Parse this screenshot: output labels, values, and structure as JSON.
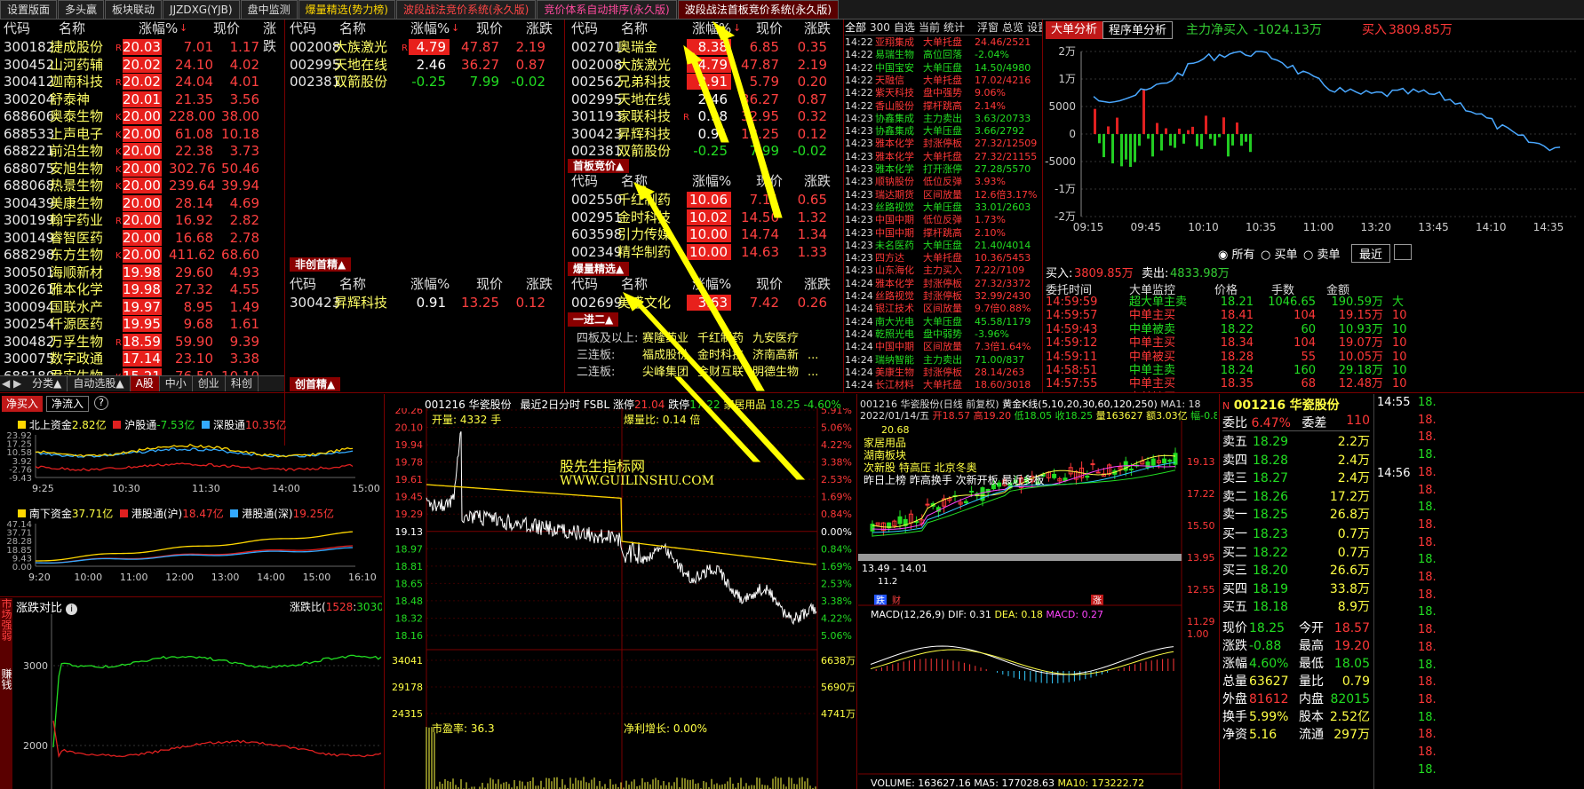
{
  "topbar": {
    "tabs": [
      {
        "label": "设置版面",
        "style": "normal"
      },
      {
        "label": "多头赢",
        "style": "normal"
      },
      {
        "label": "板块联动",
        "style": "normal"
      },
      {
        "label": "JJZDXG(YJB)",
        "style": "normal"
      },
      {
        "label": "盘中监测",
        "style": "normal"
      },
      {
        "label": "爆量精选(势力榜)",
        "style": "yellow"
      },
      {
        "label": "波段战法竞价系统(永久版)",
        "style": "red"
      },
      {
        "label": "竞价体系自动排序(永久版)",
        "style": "pink"
      },
      {
        "label": "波段战法首板竞价系统(永久版)",
        "style": "active"
      }
    ]
  },
  "left_table": {
    "headers": [
      "代码",
      "名称",
      "涨幅%",
      "现价",
      "涨跌"
    ],
    "rows": [
      {
        "code": "300182",
        "name": "捷成股份",
        "mark": "R",
        "pct": "20.03",
        "price": "7.01",
        "chg": "1.17"
      },
      {
        "code": "300452",
        "name": "山河药辅",
        "mark": "",
        "pct": "20.02",
        "price": "24.10",
        "chg": "4.02"
      },
      {
        "code": "300412",
        "name": "迦南科技",
        "mark": "R",
        "pct": "20.02",
        "price": "24.04",
        "chg": "4.01"
      },
      {
        "code": "300204",
        "name": "舒泰神",
        "mark": "",
        "pct": "20.01",
        "price": "21.35",
        "chg": "3.56"
      },
      {
        "code": "688606",
        "name": "奥泰生物",
        "mark": "K",
        "pct": "20.00",
        "price": "228.00",
        "chg": "38.00"
      },
      {
        "code": "688533",
        "name": "上声电子",
        "mark": "K",
        "pct": "20.00",
        "price": "61.08",
        "chg": "10.18"
      },
      {
        "code": "688221",
        "name": "前沿生物",
        "mark": "K",
        "pct": "20.00",
        "price": "22.38",
        "chg": "3.73"
      },
      {
        "code": "688075",
        "name": "安旭生物",
        "mark": "K",
        "pct": "20.00",
        "price": "302.76",
        "chg": "50.46"
      },
      {
        "code": "688068",
        "name": "热景生物",
        "mark": "K",
        "pct": "20.00",
        "price": "239.64",
        "chg": "39.94"
      },
      {
        "code": "300439",
        "name": "美康生物",
        "mark": "",
        "pct": "20.00",
        "price": "28.14",
        "chg": "4.69"
      },
      {
        "code": "300199",
        "name": "翰宇药业",
        "mark": "R",
        "pct": "20.00",
        "price": "16.92",
        "chg": "2.82"
      },
      {
        "code": "300149",
        "name": "睿智医药",
        "mark": "",
        "pct": "20.00",
        "price": "16.68",
        "chg": "2.78"
      },
      {
        "code": "688298",
        "name": "东方生物",
        "mark": "K",
        "pct": "20.00",
        "price": "411.62",
        "chg": "68.60"
      },
      {
        "code": "300501",
        "name": "海顺新材",
        "mark": "",
        "pct": "19.98",
        "price": "29.60",
        "chg": "4.93"
      },
      {
        "code": "300261",
        "name": "雅本化学",
        "mark": "",
        "pct": "19.98",
        "price": "27.32",
        "chg": "4.55"
      },
      {
        "code": "300094",
        "name": "国联水产",
        "mark": "",
        "pct": "19.97",
        "price": "8.95",
        "chg": "1.49"
      },
      {
        "code": "300254",
        "name": "仟源医药",
        "mark": "",
        "pct": "19.95",
        "price": "9.68",
        "chg": "1.61"
      },
      {
        "code": "300482",
        "name": "万孚生物",
        "mark": "R",
        "pct": "18.59",
        "price": "59.90",
        "chg": "9.39"
      },
      {
        "code": "300075",
        "name": "数字政通",
        "mark": "",
        "pct": "17.14",
        "price": "23.10",
        "chg": "3.38"
      },
      {
        "code": "688180",
        "name": "君实生物",
        "mark": "K",
        "pct": "15.21",
        "price": "76.50",
        "chg": "10.10"
      }
    ],
    "bottom_tabs": [
      "分类▲",
      "自动选股▲",
      "A股",
      "中小",
      "创业",
      "科创"
    ]
  },
  "mid_table": {
    "headers": [
      "代码",
      "名称",
      "涨幅%",
      "现价",
      "涨跌"
    ],
    "rows": [
      {
        "code": "002008",
        "name": "大族激光",
        "mark": "R",
        "pct": "4.79",
        "price": "47.87",
        "chg": "2.19",
        "bar": true,
        "neg": false
      },
      {
        "code": "002995",
        "name": "天地在线",
        "mark": "",
        "pct": "2.46",
        "price": "36.27",
        "chg": "0.87",
        "bar": false,
        "neg": false
      },
      {
        "code": "002381",
        "name": "双箭股份",
        "mark": "",
        "pct": "-0.25",
        "price": "7.99",
        "chg": "-0.02",
        "bar": false,
        "neg": true
      }
    ],
    "section2_label": "非创首精▲",
    "headers2": [
      "代码",
      "名称",
      "涨幅%",
      "现价",
      "涨跌"
    ],
    "rows2": [
      {
        "code": "300423",
        "name": "昇辉科技",
        "pct": "0.91",
        "price": "13.25",
        "chg": "0.12"
      }
    ],
    "bottom_label": "创首精▲"
  },
  "right_table": {
    "headers": [
      "代码",
      "名称",
      "涨幅%",
      "现价",
      "涨跌"
    ],
    "rows": [
      {
        "code": "002701",
        "name": "奥瑞金",
        "pct": "8.38",
        "price": "6.85",
        "chg": "0.35",
        "bar": true,
        "neg": false,
        "mark": ""
      },
      {
        "code": "002008",
        "name": "大族激光",
        "pct": "4.79",
        "price": "47.87",
        "chg": "2.19",
        "bar": true,
        "neg": false,
        "mark": ""
      },
      {
        "code": "002562",
        "name": "兄弟科技",
        "pct": "3.91",
        "price": "5.79",
        "chg": "0.20",
        "bar": true,
        "neg": false,
        "mark": ""
      },
      {
        "code": "002995",
        "name": "天地在线",
        "pct": "2.46",
        "price": "36.27",
        "chg": "0.87",
        "bar": false,
        "neg": false,
        "mark": ""
      },
      {
        "code": "301193",
        "name": "家联科技",
        "pct": "0.98",
        "price": "32.95",
        "chg": "0.32",
        "bar": false,
        "neg": false,
        "mark": "R"
      },
      {
        "code": "300423",
        "name": "昇辉科技",
        "pct": "0.91",
        "price": "13.25",
        "chg": "0.12",
        "bar": false,
        "neg": false,
        "mark": ""
      },
      {
        "code": "002381",
        "name": "双箭股份",
        "pct": "-0.25",
        "price": "7.99",
        "chg": "-0.02",
        "bar": false,
        "neg": true,
        "mark": ""
      }
    ],
    "sec_first_label": "首板竞价▲",
    "headers_first": [
      "代码",
      "名称",
      "涨幅%",
      "现价",
      "涨跌"
    ],
    "rows_first": [
      {
        "code": "002550",
        "name": "千红制药",
        "pct": "10.06",
        "price": "7.11",
        "chg": "0.65"
      },
      {
        "code": "002951",
        "name": "金时科技",
        "pct": "10.02",
        "price": "14.50",
        "chg": "1.32"
      },
      {
        "code": "603598",
        "name": "引力传媒",
        "pct": "10.00",
        "price": "14.74",
        "chg": "1.34"
      },
      {
        "code": "002349",
        "name": "精华制药",
        "pct": "10.00",
        "price": "14.63",
        "chg": "1.33"
      }
    ],
    "sec_burst_label": "爆量精选▲",
    "headers_burst": [
      "代码",
      "名称",
      "涨幅%",
      "现价",
      "涨跌"
    ],
    "rows_burst": [
      {
        "code": "002699",
        "name": "美盛文化",
        "pct": "3.63",
        "price": "7.42",
        "chg": "0.26"
      }
    ],
    "sec_one2_label": "一进二▲",
    "boards": [
      {
        "label": "四板及以上:",
        "items": [
          "赛隆药业",
          "千红制药",
          "九安医疗"
        ]
      },
      {
        "label": "三连板:",
        "items": [
          "福成股份",
          "金时科技",
          "济南高新",
          "..."
        ]
      },
      {
        "label": "二连板:",
        "items": [
          "尖峰集团",
          "金财互联",
          "明德生物",
          "..."
        ]
      }
    ]
  },
  "monitor": {
    "tabs": [
      "全部",
      "300",
      "自选",
      "当前",
      "统计",
      "浮窗",
      "总览",
      "设置"
    ],
    "rows": [
      {
        "time": "14:22",
        "name": "亚翔集成",
        "type": "大单托盘",
        "val": "24.46/2521",
        "tc": "red"
      },
      {
        "time": "14:22",
        "name": "易瑞生物",
        "type": "高位回落",
        "val": "-2.04%",
        "tc": "green"
      },
      {
        "time": "14:22",
        "name": "中国宝安",
        "type": "大单压盘",
        "val": "14.50/4980",
        "tc": "green"
      },
      {
        "time": "14:22",
        "name": "天融信",
        "type": "大单托盘",
        "val": "17.02/4216",
        "tc": "red"
      },
      {
        "time": "14:22",
        "name": "紫天科技",
        "type": "盘中强势",
        "val": "9.06%",
        "tc": "red"
      },
      {
        "time": "14:22",
        "name": "香山股份",
        "type": "撑杆跳高",
        "val": "2.14%",
        "tc": "red"
      },
      {
        "time": "14:23",
        "name": "协鑫集成",
        "type": "主力卖出",
        "val": "3.63/20733",
        "tc": "green"
      },
      {
        "time": "14:23",
        "name": "协鑫集成",
        "type": "大单压盘",
        "val": "3.66/2792",
        "tc": "green"
      },
      {
        "time": "14:23",
        "name": "雅本化学",
        "type": "封涨停板",
        "val": "27.32/12509",
        "tc": "red"
      },
      {
        "time": "14:23",
        "name": "雅本化学",
        "type": "大单托盘",
        "val": "27.32/21155",
        "tc": "red"
      },
      {
        "time": "14:23",
        "name": "雅本化学",
        "type": "打开涨停",
        "val": "27.28/5570",
        "tc": "green"
      },
      {
        "time": "14:23",
        "name": "顺钠股份",
        "type": "低位反弹",
        "val": "3.93%",
        "tc": "red"
      },
      {
        "time": "14:23",
        "name": "瑞达期货",
        "type": "区间放量",
        "val": "12.6倍3.17%",
        "tc": "red"
      },
      {
        "time": "14:23",
        "name": "丝路视觉",
        "type": "大单压盘",
        "val": "33.01/2603",
        "tc": "green"
      },
      {
        "time": "14:23",
        "name": "中国中期",
        "type": "低位反弹",
        "val": "1.73%",
        "tc": "red"
      },
      {
        "time": "14:23",
        "name": "中国中期",
        "type": "撑杆跳高",
        "val": "2.10%",
        "tc": "red"
      },
      {
        "time": "14:23",
        "name": "未名医药",
        "type": "大单压盘",
        "val": "21.40/4014",
        "tc": "green"
      },
      {
        "time": "14:23",
        "name": "四方达",
        "type": "大单托盘",
        "val": "10.36/5453",
        "tc": "red"
      },
      {
        "time": "14:23",
        "name": "山东海化",
        "type": "主力买入",
        "val": "7.22/7109",
        "tc": "red"
      },
      {
        "time": "14:24",
        "name": "雅本化学",
        "type": "封涨停板",
        "val": "27.32/3372",
        "tc": "red"
      },
      {
        "time": "14:24",
        "name": "丝路视觉",
        "type": "封涨停板",
        "val": "32.99/2430",
        "tc": "red"
      },
      {
        "time": "14:24",
        "name": "银江技术",
        "type": "区间放量",
        "val": "9.7倍0.88%",
        "tc": "red"
      },
      {
        "time": "14:24",
        "name": "南大光电",
        "type": "大单压盘",
        "val": "45.58/1179",
        "tc": "green"
      },
      {
        "time": "14:24",
        "name": "乾照光电",
        "type": "盘中弱势",
        "val": "-3.96%",
        "tc": "green"
      },
      {
        "time": "14:24",
        "name": "中国中期",
        "type": "区间放量",
        "val": "7.3倍1.64%",
        "tc": "red"
      },
      {
        "time": "14:24",
        "name": "瑞纳智能",
        "type": "主力卖出",
        "val": "71.00/837",
        "tc": "green"
      },
      {
        "time": "14:24",
        "name": "美康生物",
        "type": "封涨停板",
        "val": "28.14/263",
        "tc": "red"
      },
      {
        "time": "14:24",
        "name": "长江材料",
        "type": "大单托盘",
        "val": "18.60/3018",
        "tc": "red"
      }
    ]
  },
  "bigorder": {
    "btn1": "大单分析",
    "btn2": "程序单分析",
    "net_label": "主力净买入",
    "net_val": "-1024.13万",
    "buy_label": "买入",
    "buy_val": "3809.85万",
    "y_labels": [
      "2万",
      "1万",
      "5000",
      "0",
      "-5000",
      "-1万",
      "-2万"
    ],
    "x_labels": [
      "09:15",
      "09:45",
      "10:10",
      "10:35",
      "11:00",
      "13:20",
      "13:45",
      "14:10",
      "14:35"
    ],
    "radios": [
      "所有",
      "买单",
      "卖单"
    ],
    "recent_btn": "最近",
    "buy_total_label": "买入:",
    "buy_total": "3809.85万",
    "sell_total_label": "卖出:",
    "sell_total": "4833.98万",
    "table_headers": [
      "委托时间",
      "大单监控",
      "价格",
      "手数",
      "金额"
    ],
    "table_rows": [
      {
        "time": "14:59:59",
        "kind": "超大单主卖",
        "price": "18.21",
        "lots": "1046.65",
        "amt": "190.59万",
        "extra": "大"
      },
      {
        "time": "14:59:57",
        "kind": "中单主买",
        "price": "18.41",
        "lots": "104",
        "amt": "19.15万",
        "extra": "10"
      },
      {
        "time": "14:59:43",
        "kind": "中单被卖",
        "price": "18.22",
        "lots": "60",
        "amt": "10.93万",
        "extra": "10"
      },
      {
        "time": "14:59:12",
        "kind": "中单主买",
        "price": "18.34",
        "lots": "104",
        "amt": "19.07万",
        "extra": "10"
      },
      {
        "time": "14:59:11",
        "kind": "中单被买",
        "price": "18.28",
        "lots": "55",
        "amt": "10.05万",
        "extra": "10"
      },
      {
        "time": "14:58:51",
        "kind": "中单主卖",
        "price": "18.24",
        "lots": "160",
        "amt": "29.18万",
        "extra": "10"
      },
      {
        "time": "14:57:55",
        "kind": "中单主买",
        "price": "18.35",
        "lots": "68",
        "amt": "12.48万",
        "extra": "10"
      },
      {
        "time": "14:57:50",
        "kind": "中单被买",
        "price": "18.29",
        "lots": "64",
        "amt": "11.71万",
        "extra": "10"
      },
      {
        "time": "14:57:49",
        "kind": "中单被买",
        "price": "18.25",
        "lots": "109",
        "amt": "19.89万",
        "extra": "15"
      }
    ]
  },
  "hsgt": {
    "btn_buy": "净买入",
    "btn_flow": "净流入",
    "north_label": "北上资金",
    "north_val": "2.82亿",
    "sh_label": "沪股通",
    "sh_val": "-7.53亿",
    "sz_label": "深股通",
    "sz_val": "10.35亿",
    "north_y": [
      "23.92",
      "17.25",
      "10.58",
      "3.92",
      "-2.76",
      "-9.43"
    ],
    "north_x": [
      "9:25",
      "10:30",
      "11:30",
      "14:00",
      "15:00"
    ],
    "south_label": "南下资金",
    "south_val": "37.71亿",
    "hk_sh_label": "港股通(沪)",
    "hk_sh_val": "18.47亿",
    "hk_sz_label": "港股通(深)",
    "hk_sz_val": "19.25亿",
    "south_y": [
      "47.14",
      "37.71",
      "28.28",
      "18.85",
      "9.43",
      "0.00"
    ],
    "south_x": [
      "9:20",
      "10:00",
      "11:00",
      "12:00",
      "13:00",
      "14:00",
      "15:00",
      "16:10"
    ],
    "ratio_side": "市场强弱",
    "ratio_title": "涨跌对比",
    "ratio_label": "涨跌比",
    "ratio_up": "1528",
    "ratio_down": "3030",
    "ratio_y": [
      "3000",
      "2000"
    ],
    "ratio_side2": "赚钱"
  },
  "intraday": {
    "title_code": "001216",
    "title_name": "华瓷股份",
    "title_desc": "最近2日分时 FSBL",
    "limit_up_label": "涨停",
    "limit_up": "21.04",
    "limit_down_label": "跌停",
    "limit_down": "17.22",
    "sector": "家居用品",
    "sector_val": "18.25",
    "sector_pct": "-4.60%",
    "kailiang": "开量: 4332 手",
    "baoliang": "爆量比: 0.14 倍",
    "watermark1": "股先生指标网",
    "watermark2": "WWW.GUILINSHU.COM",
    "y_left": [
      "20.26",
      "20.10",
      "19.94",
      "19.78",
      "19.61",
      "19.45",
      "19.29",
      "19.13",
      "18.97",
      "18.81",
      "18.65",
      "18.48",
      "18.32",
      "18.16"
    ],
    "y_right": [
      "5.91%",
      "5.06%",
      "4.22%",
      "3.38%",
      "2.53%",
      "1.69%",
      "0.84%",
      "0.00%",
      "0.84%",
      "1.69%",
      "2.53%",
      "3.38%",
      "4.22%",
      "5.06%"
    ],
    "pe_label": "市盈率: 36.3",
    "growth_label": "净利增长: 0.00%",
    "vol_left": [
      "34041",
      "29178",
      "24315"
    ],
    "vol_right": [
      "6638万",
      "5690万",
      "4741万"
    ]
  },
  "kline": {
    "title": "001216 华瓷股份(日线 前复权)",
    "ind": "黄金K线(5,10,20,30,60,120,250)",
    "ma1": "MA1: 18",
    "date": "2022/01/14/五",
    "open": "开18.57",
    "high": "高19.20",
    "low": "低18.05",
    "close": "收18.25",
    "vol": "量163627",
    "turnover": "额3.03亿",
    "amp": "幅-0.88",
    "tag_price": "20.68",
    "tags1": "家居用品",
    "tags2": "湖南板块",
    "tags3": "次新股 特高压 北京冬奥",
    "tags4": "昨日上榜 昨高换手 次新开板 最近多板",
    "y_right": [
      "19.13",
      "17.22",
      "15.50",
      "13.95",
      "12.55",
      "11.29"
    ],
    "range": "13.49 - 14.01",
    "macd_title": "MACD(12,26,9)",
    "macd_dif": "DIF: 0.31",
    "macd_dea": "DEA: 0.18",
    "macd_val": "MACD: 0.27",
    "macd_y": "1.00",
    "vol_title": "VOLUME: 163627.16",
    "vol_ma5": "MA5: 177028.63",
    "vol_ma10": "MA10: 173222.72",
    "low_mark": "11.2",
    "badge1": "跌",
    "badge2": "财",
    "badge3": "涨"
  },
  "quote": {
    "code": "001216",
    "name": "华瓷股份",
    "webi_label": "委比",
    "webi": "6.47%",
    "wecha_label": "委差",
    "wecha": "110",
    "asks": [
      {
        "label": "卖五",
        "price": "18.29",
        "vol": "2.2万"
      },
      {
        "label": "卖四",
        "price": "18.28",
        "vol": "2.4万"
      },
      {
        "label": "卖三",
        "price": "18.27",
        "vol": "2.4万"
      },
      {
        "label": "卖二",
        "price": "18.26",
        "vol": "17.2万"
      },
      {
        "label": "卖一",
        "price": "18.25",
        "vol": "26.8万"
      }
    ],
    "bids": [
      {
        "label": "买一",
        "price": "18.23",
        "vol": "0.7万"
      },
      {
        "label": "买二",
        "price": "18.22",
        "vol": "0.7万"
      },
      {
        "label": "买三",
        "price": "18.20",
        "vol": "26.6万"
      },
      {
        "label": "买四",
        "price": "18.19",
        "vol": "33.8万"
      },
      {
        "label": "买五",
        "price": "18.18",
        "vol": "8.9万"
      }
    ],
    "stats": [
      {
        "l1": "现价",
        "v1": "18.25",
        "c1": "green",
        "l2": "今开",
        "v2": "18.57",
        "c2": "red"
      },
      {
        "l1": "涨跌",
        "v1": "-0.88",
        "c1": "green",
        "l2": "最高",
        "v2": "19.20",
        "c2": "red"
      },
      {
        "l1": "涨幅",
        "v1": "4.60%",
        "c1": "green",
        "l2": "最低",
        "v2": "18.05",
        "c2": "green"
      },
      {
        "l1": "总量",
        "v1": "63627",
        "c1": "yel",
        "l2": "量比",
        "v2": "0.79",
        "c2": "yel"
      },
      {
        "l1": "外盘",
        "v1": "81612",
        "c1": "red",
        "l2": "内盘",
        "v2": "82015",
        "c2": "green"
      },
      {
        "l1": "换手",
        "v1": "5.99%",
        "c1": "yel",
        "l2": "股本",
        "v2": "2.52亿",
        "c2": "yel"
      },
      {
        "l1": "净资",
        "v1": "5.16",
        "c1": "yel",
        "l2": "流通",
        "v2": "297万",
        "c2": "yel"
      }
    ],
    "side_time1": "14:55",
    "side_time2": "14:56",
    "side_val": "18."
  }
}
